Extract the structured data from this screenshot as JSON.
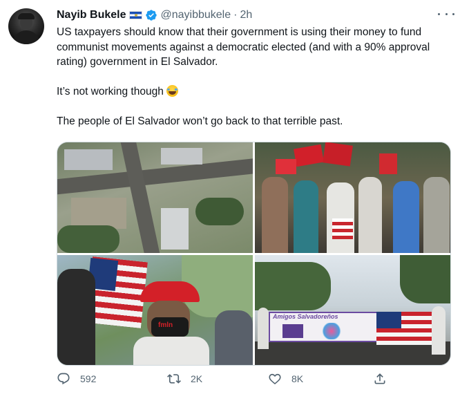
{
  "author": {
    "name": "Nayib Bukele",
    "handle": "@nayibbukele",
    "separator": "·",
    "time": "2h"
  },
  "icons": {
    "flag": "el-salvador-flag-icon",
    "verified": "verified-badge-icon",
    "more": "more-options-icon",
    "emoji": "joy-face-emoji-icon",
    "reply": "reply-icon",
    "retweet": "retweet-icon",
    "like": "heart-icon",
    "share": "share-icon"
  },
  "tweet": {
    "line1": "US taxpayers should know that their government is using their money to fund communist movements against a democratic elected (and with a 90% approval rating) government in El Salvador.",
    "line2": "It’s not working though",
    "line3": "The people of El Salvador won’t go back to that terrible past."
  },
  "media": {
    "banner_text": "Amigos Salvadoreños",
    "cap_text": "fmln"
  },
  "stats": {
    "replies": "592",
    "retweets": "2K",
    "likes": "8K"
  },
  "colors": {
    "text_primary": "#0f1419",
    "text_secondary": "#536471",
    "verified_blue": "#1d9bf0",
    "border": "#cfd9de"
  }
}
